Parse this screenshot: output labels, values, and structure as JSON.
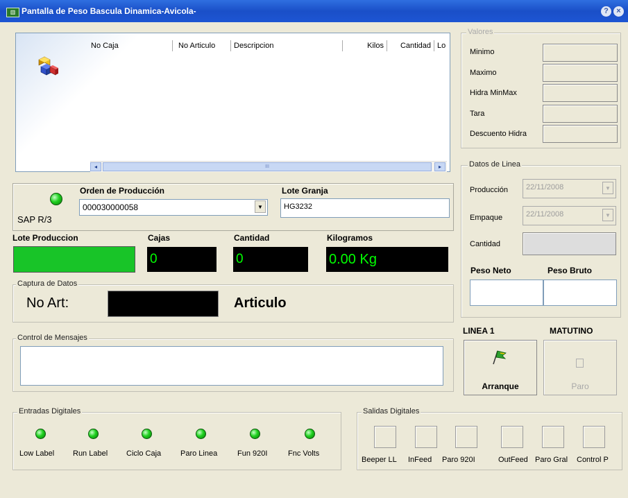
{
  "window": {
    "title": "Pantalla de Peso Bascula Dinamica-Avicola-",
    "app_icon": "app-icon",
    "help_label": "?",
    "close_label": "×"
  },
  "grid": {
    "columns": [
      "No Caja",
      "No Articulo",
      "Descripcion",
      "Kilos",
      "Cantidad",
      "Lo"
    ],
    "icon": "cubes-icon",
    "scroll_left": "◂",
    "scroll_right": "▸",
    "scroll_grip": "III"
  },
  "valores": {
    "title": "Valores",
    "labels": [
      "Minimo",
      "Maximo",
      "Hidra MinMax",
      "Tara",
      "Descuento Hidra"
    ]
  },
  "order": {
    "status_label": "SAP R/3",
    "orden_label": "Orden de Producción",
    "orden_value": "000030000058",
    "lote_granja_label": "Lote Granja",
    "lote_granja_value": "HG3232",
    "dropdown_arrow": "▼"
  },
  "summary": {
    "lote_produccion_label": "Lote Produccion",
    "cajas_label": "Cajas",
    "cajas_value": "0",
    "cantidad_label": "Cantidad",
    "cantidad_value": "0",
    "kilogramos_label": "Kilogramos",
    "kilogramos_value": "0.00 Kg"
  },
  "captura": {
    "title": "Captura de Datos",
    "no_art_label": "No Art:",
    "articulo_label": "Articulo"
  },
  "datos_linea": {
    "title": "Datos de Linea",
    "produccion_label": "Producción",
    "produccion_value": "22/11/2008",
    "empaque_label": "Empaque",
    "empaque_value": "22/11/2008",
    "cantidad_label": "Cantidad",
    "peso_neto_label": "Peso Neto",
    "peso_bruto_label": "Peso Bruto"
  },
  "linea": {
    "line_label": "LINEA 1",
    "shift_label": "MATUTINO",
    "arranque_label": "Arranque",
    "paro_label": "Paro",
    "arranque_icon": "green-flag-icon",
    "paro_icon": "stop-icon"
  },
  "mensajes": {
    "title": "Control de Mensajes"
  },
  "entradas": {
    "title": "Entradas Digitales",
    "items": [
      "Low Label",
      "Run Label",
      "Ciclo Caja",
      "Paro Linea",
      "Fun 920I",
      "Fnc Volts"
    ]
  },
  "salidas": {
    "title": "Salidas Digitales",
    "items": [
      "Beeper LL",
      "InFeed",
      "Paro 920I",
      "OutFeed",
      "Paro Gral",
      "Control P"
    ]
  },
  "colors": {
    "led_green": "#1fd01f",
    "lote_fill": "#18c428",
    "display_text": "#00ff00",
    "title_blue": "#1a4fc8"
  }
}
